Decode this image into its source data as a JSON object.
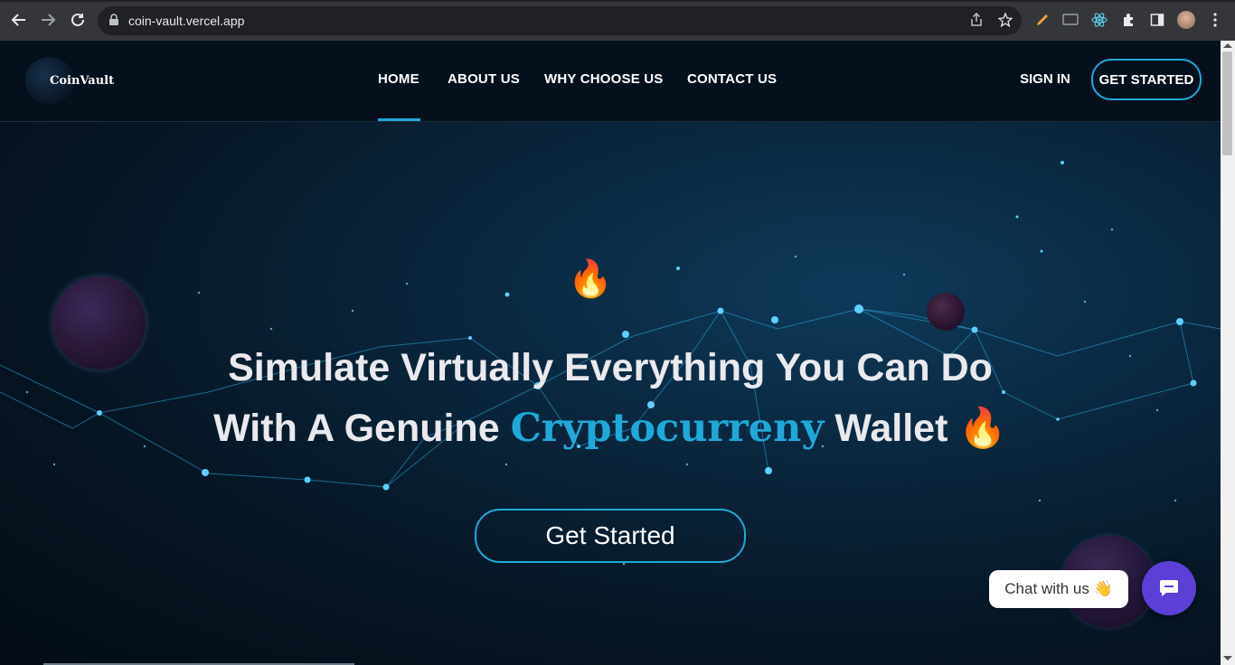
{
  "browser": {
    "url": "coin-vault.vercel.app"
  },
  "header": {
    "logo_text": "CoinVault",
    "nav": [
      "HOME",
      "ABOUT US",
      "WHY CHOOSE US",
      "CONTACT US"
    ],
    "sign_in": "SIGN IN",
    "get_started": "GET STARTED"
  },
  "hero": {
    "emoji": "🔥",
    "line1": "Simulate Virtually Everything You Can Do",
    "line2_prefix": "With A Genuine",
    "line2_accent": "Cryptocurreny",
    "line2_suffix": "Wallet 🔥",
    "button": "Get Started"
  },
  "chat": {
    "bubble": "Chat with us 👋"
  },
  "colors": {
    "accent": "#1fa9d8",
    "chat_button": "#5b3fd6",
    "header_bg": "#04101c"
  }
}
